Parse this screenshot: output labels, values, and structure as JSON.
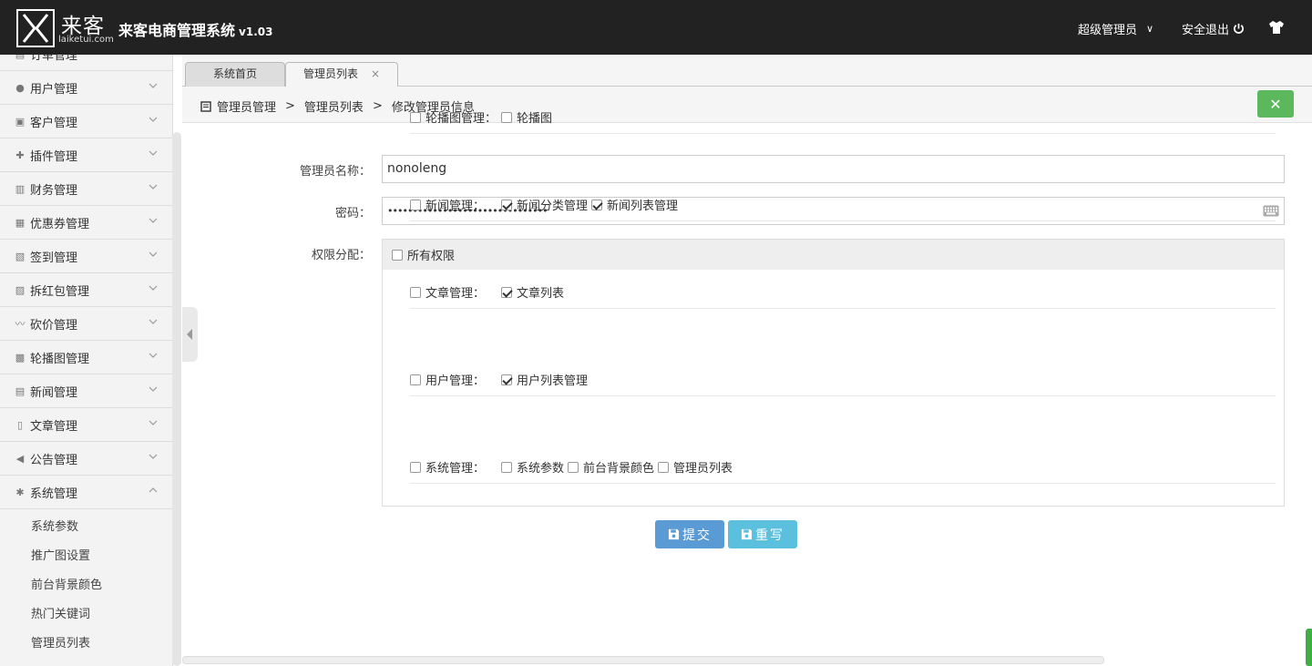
{
  "header": {
    "logo_cn": "来客",
    "logo_en": "laiketui.com",
    "title": "来客电商管理系统",
    "version": "v1.03",
    "user": "超级管理员",
    "logout": "安全退出"
  },
  "sidebar": {
    "items": [
      {
        "label": "订单管理",
        "icon": "order-icon"
      },
      {
        "label": "用户管理",
        "icon": "user-icon"
      },
      {
        "label": "客户管理",
        "icon": "customer-icon"
      },
      {
        "label": "插件管理",
        "icon": "puzzle-icon"
      },
      {
        "label": "财务管理",
        "icon": "money-icon"
      },
      {
        "label": "优惠券管理",
        "icon": "coupon-icon"
      },
      {
        "label": "签到管理",
        "icon": "clipboard-icon"
      },
      {
        "label": "拆红包管理",
        "icon": "redpacket-icon"
      },
      {
        "label": "砍价管理",
        "icon": "trend-icon"
      },
      {
        "label": "轮播图管理",
        "icon": "image-icon"
      },
      {
        "label": "新闻管理",
        "icon": "news-icon"
      },
      {
        "label": "文章管理",
        "icon": "file-icon"
      },
      {
        "label": "公告管理",
        "icon": "bullhorn-icon"
      },
      {
        "label": "系统管理",
        "icon": "gear-icon"
      }
    ],
    "sub_items": [
      "系统参数",
      "推广图设置",
      "前台背景颜色",
      "热门关键词",
      "管理员列表"
    ]
  },
  "tabs": [
    {
      "label": "系统首页"
    },
    {
      "label": "管理员列表",
      "close": "×"
    }
  ],
  "breadcrumb": {
    "items": [
      "管理员管理",
      "管理员列表",
      "修改管理员信息"
    ],
    "sep": ">"
  },
  "form": {
    "name_label": "管理员名称：",
    "name_value": "nonoleng",
    "password_label": "密码：",
    "password_value": "••••••••••••••••••••••••••••••••",
    "perm_label": "权限分配：",
    "all_perms": "所有权限",
    "groups": [
      {
        "name": "轮播图管理：",
        "items": [
          {
            "label": "轮播图",
            "checked": false
          }
        ]
      },
      {
        "name": "新闻管理：",
        "items": [
          {
            "label": "新闻分类管理",
            "checked": true
          },
          {
            "label": "新闻列表管理",
            "checked": true
          }
        ]
      },
      {
        "name": "文章管理：",
        "items": [
          {
            "label": "文章列表",
            "checked": true
          }
        ]
      },
      {
        "name": "用户管理：",
        "items": [
          {
            "label": "用户列表管理",
            "checked": true
          }
        ]
      },
      {
        "name": "系统管理：",
        "items": [
          {
            "label": "系统参数",
            "checked": false
          },
          {
            "label": "前台背景颜色",
            "checked": false
          },
          {
            "label": "管理员列表",
            "checked": false
          }
        ]
      }
    ],
    "submit": "提交",
    "reset": "重写"
  }
}
